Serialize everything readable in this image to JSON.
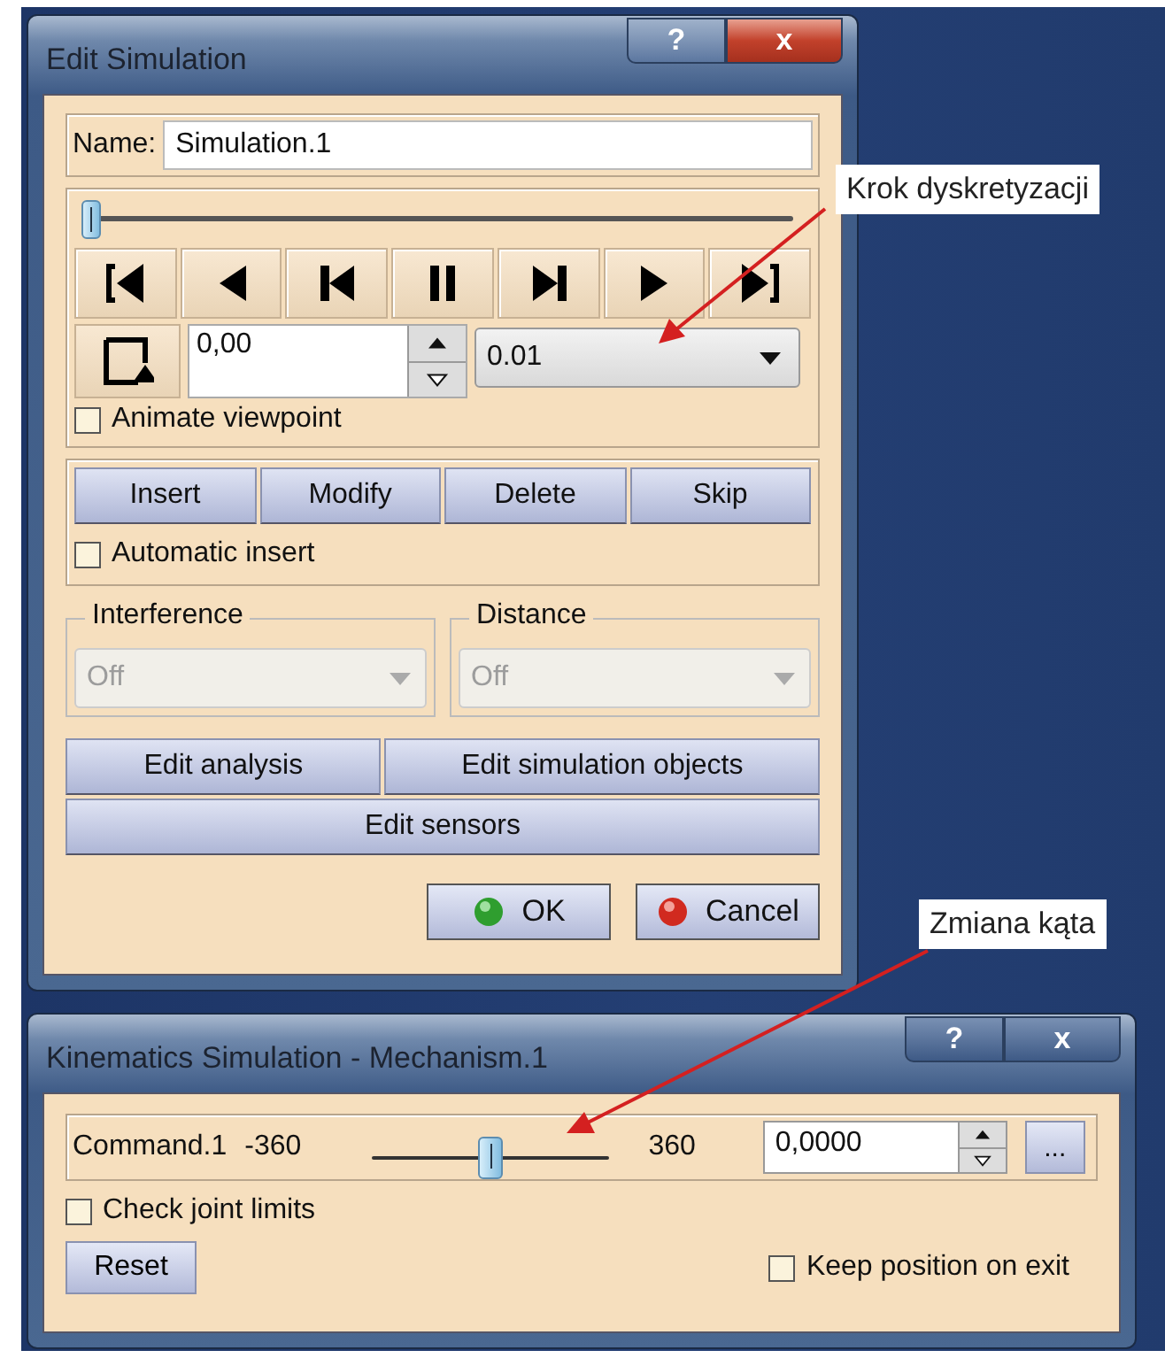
{
  "edit_simulation": {
    "title": "Edit Simulation",
    "help": "?",
    "close": "x",
    "name_label": "Name:",
    "name_value": "Simulation.1",
    "time_slider": {
      "level": 0.0
    },
    "step_value": "0,00",
    "step_size": "0.01",
    "animate_viewpoint": {
      "label": "Animate viewpoint",
      "checked": false
    },
    "record_buttons": [
      "Insert",
      "Modify",
      "Delete",
      "Skip"
    ],
    "automatic_insert": {
      "label": "Automatic insert",
      "checked": false
    },
    "groups": [
      {
        "label": "Interference",
        "value": "Off",
        "disabled": true
      },
      {
        "label": "Distance",
        "value": "Off",
        "disabled": true
      }
    ],
    "edit_buttons": [
      "Edit analysis",
      "Edit simulation objects"
    ],
    "sensors_button": "Edit sensors",
    "ok": "OK",
    "cancel": "Cancel"
  },
  "kinematics_simulation": {
    "title": "Kinematics Simulation - Mechanism.1",
    "help": "?",
    "close": "x",
    "command": {
      "name": "Command.1",
      "min": "-360",
      "max": "360",
      "level": 0.5,
      "value": "0,0000",
      "more": "..."
    },
    "check_joint_limits": {
      "label": "Check joint limits",
      "checked": false
    },
    "reset": "Reset",
    "keep_position": {
      "label": "Keep position on exit",
      "checked": false
    }
  },
  "annotations": [
    {
      "text": "Krok dyskretyzacji"
    },
    {
      "text": "Zmiana kąta"
    }
  ]
}
